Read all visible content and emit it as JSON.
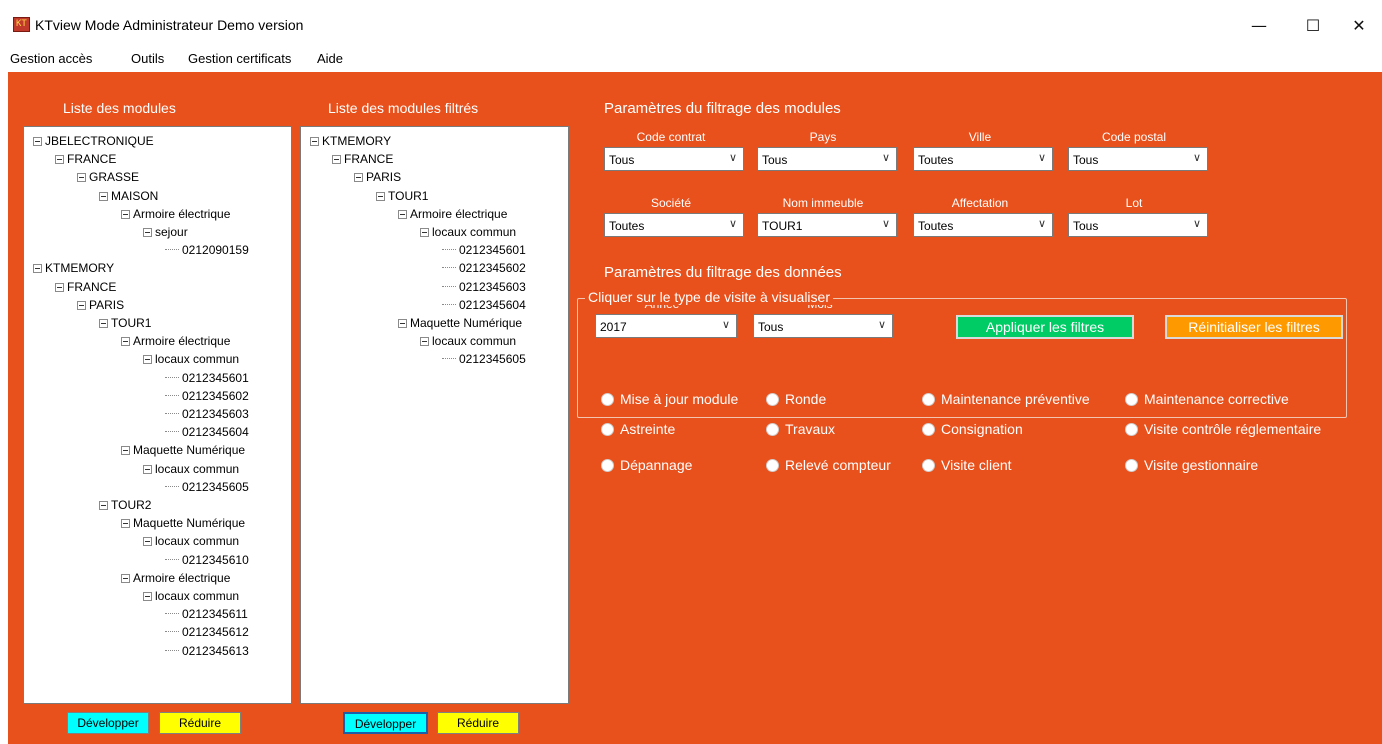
{
  "window": {
    "title": "KTview Mode Administrateur Demo version",
    "minimize_glyph": "—",
    "maximize_glyph": "☐",
    "close_glyph": "✕"
  },
  "menu": [
    "Gestion accès",
    "Outils",
    "Gestion certificats",
    "Aide"
  ],
  "colors": {
    "background": "#e8501c",
    "developper": "#00ffff",
    "reduire": "#ffff00",
    "apply": "#00cc66",
    "reset": "#ff9900"
  },
  "left_panel": {
    "title": "Liste des modules",
    "tree": [
      {
        "label": "JBELECTRONIQUE",
        "depth": 0,
        "expanded": true
      },
      {
        "label": "FRANCE",
        "depth": 1,
        "expanded": true
      },
      {
        "label": "GRASSE",
        "depth": 2,
        "expanded": true
      },
      {
        "label": "MAISON",
        "depth": 3,
        "expanded": true
      },
      {
        "label": "Armoire électrique",
        "depth": 4,
        "expanded": true
      },
      {
        "label": "sejour",
        "depth": 5,
        "expanded": true
      },
      {
        "label": "0212090159",
        "depth": 6,
        "expanded": false
      },
      {
        "label": "KTMEMORY",
        "depth": 0,
        "expanded": true
      },
      {
        "label": "FRANCE",
        "depth": 1,
        "expanded": true
      },
      {
        "label": "PARIS",
        "depth": 2,
        "expanded": true
      },
      {
        "label": "TOUR1",
        "depth": 3,
        "expanded": true
      },
      {
        "label": "Armoire électrique",
        "depth": 4,
        "expanded": true
      },
      {
        "label": "locaux commun",
        "depth": 5,
        "expanded": true
      },
      {
        "label": "0212345601",
        "depth": 6,
        "expanded": false
      },
      {
        "label": "0212345602",
        "depth": 6,
        "expanded": false
      },
      {
        "label": "0212345603",
        "depth": 6,
        "expanded": false
      },
      {
        "label": "0212345604",
        "depth": 6,
        "expanded": false
      },
      {
        "label": "Maquette Numérique",
        "depth": 4,
        "expanded": true
      },
      {
        "label": "locaux commun",
        "depth": 5,
        "expanded": true
      },
      {
        "label": "0212345605",
        "depth": 6,
        "expanded": false
      },
      {
        "label": "TOUR2",
        "depth": 3,
        "expanded": true
      },
      {
        "label": "Maquette Numérique",
        "depth": 4,
        "expanded": true
      },
      {
        "label": "locaux commun",
        "depth": 5,
        "expanded": true
      },
      {
        "label": "0212345610",
        "depth": 6,
        "expanded": false
      },
      {
        "label": "Armoire électrique",
        "depth": 4,
        "expanded": true
      },
      {
        "label": "locaux commun",
        "depth": 5,
        "expanded": true
      },
      {
        "label": "0212345611",
        "depth": 6,
        "expanded": false
      },
      {
        "label": "0212345612",
        "depth": 6,
        "expanded": false
      },
      {
        "label": "0212345613",
        "depth": 6,
        "expanded": false
      }
    ],
    "expand_label": "Développer",
    "collapse_label": "Réduire"
  },
  "middle_panel": {
    "title": "Liste des modules filtrés",
    "tree": [
      {
        "label": "KTMEMORY",
        "depth": 0,
        "expanded": true
      },
      {
        "label": "FRANCE",
        "depth": 1,
        "expanded": true
      },
      {
        "label": "PARIS",
        "depth": 2,
        "expanded": true
      },
      {
        "label": "TOUR1",
        "depth": 3,
        "expanded": true
      },
      {
        "label": "Armoire électrique",
        "depth": 4,
        "expanded": true
      },
      {
        "label": "locaux commun",
        "depth": 5,
        "expanded": true
      },
      {
        "label": "0212345601",
        "depth": 6,
        "expanded": false
      },
      {
        "label": "0212345602",
        "depth": 6,
        "expanded": false
      },
      {
        "label": "0212345603",
        "depth": 6,
        "expanded": false
      },
      {
        "label": "0212345604",
        "depth": 6,
        "expanded": false
      },
      {
        "label": "Maquette Numérique",
        "depth": 4,
        "expanded": true
      },
      {
        "label": "locaux commun",
        "depth": 5,
        "expanded": true
      },
      {
        "label": "0212345605",
        "depth": 6,
        "expanded": false
      }
    ],
    "expand_label": "Développer",
    "collapse_label": "Réduire"
  },
  "module_filters": {
    "title": "Paramètres du filtrage des modules",
    "fields": [
      {
        "label": "Code contrat",
        "value": "Tous"
      },
      {
        "label": "Pays",
        "value": "Tous"
      },
      {
        "label": "Ville",
        "value": "Toutes"
      },
      {
        "label": "Code postal",
        "value": "Tous"
      },
      {
        "label": "Société",
        "value": "Toutes"
      },
      {
        "label": "Nom immeuble",
        "value": "TOUR1"
      },
      {
        "label": "Affectation",
        "value": "Toutes"
      },
      {
        "label": "Lot",
        "value": "Tous"
      }
    ]
  },
  "data_filters": {
    "title": "Paramètres du filtrage des données",
    "year_label": "Année",
    "year_value": "2017",
    "month_label": "Mois",
    "month_value": "Tous",
    "apply_label": "Appliquer les filtres",
    "reset_label": "Réinitialiser les filtres"
  },
  "visit_types": {
    "title": "Cliquer sur le type de visite à visualiser",
    "options": [
      "Mise à jour module",
      "Ronde",
      "Maintenance préventive",
      "Maintenance corrective",
      "Astreinte",
      "Travaux",
      "Consignation",
      "Visite contrôle réglementaire",
      "Dépannage",
      "Relevé compteur",
      "Visite client",
      "Visite gestionnaire"
    ]
  }
}
